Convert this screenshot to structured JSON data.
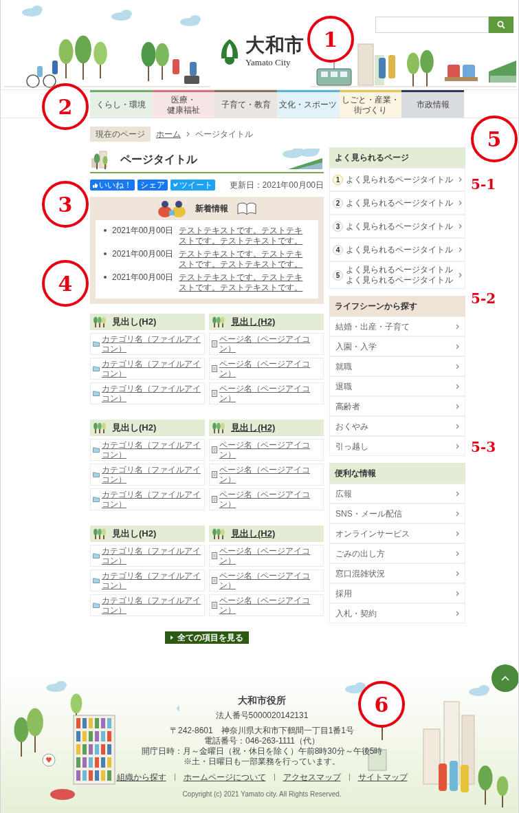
{
  "header": {
    "logo": {
      "name": "大和市",
      "romaji": "Yamato City"
    }
  },
  "nav": [
    {
      "lines": [
        "くらし・環境"
      ],
      "color": "#6fb06a"
    },
    {
      "lines": [
        "医療・",
        "健康福祉"
      ],
      "color": "#d9727a"
    },
    {
      "lines": [
        "子育て・教育"
      ],
      "color": "#8a7458"
    },
    {
      "lines": [
        "文化・スポーツ"
      ],
      "color": "#5bb5d8"
    },
    {
      "lines": [
        "しごと・産業・",
        "街づくり"
      ],
      "color": "#e8c25a"
    },
    {
      "lines": [
        "市政情報"
      ],
      "color": "#2d3a5a"
    }
  ],
  "breadcrumb": {
    "label": "現在のページ",
    "items": [
      {
        "text": "ホーム",
        "kind": "link"
      },
      {
        "text": "ページタイトル",
        "kind": "current"
      }
    ]
  },
  "page_title": "ページタイトル",
  "share_buttons": [
    {
      "label": "いいね！",
      "kind": "like"
    },
    {
      "label": "シェア",
      "kind": "share"
    },
    {
      "label": "ツイート",
      "kind": "tweet"
    }
  ],
  "updated": "更新日：2021年00月00日",
  "news": {
    "title": "新着情報",
    "items": [
      {
        "date": "2021年00月00日",
        "text": "テストテキストです。テストテキストです。テストテキストです。"
      },
      {
        "date": "2021年00月00日",
        "text": "テストテキストです。テストテキストです。テストテキストです。"
      },
      {
        "date": "2021年00月00日",
        "text": "テストテキストです。テストテキストです。テストテキストです。"
      }
    ]
  },
  "sections": [
    {
      "heading": "見出し(H2)",
      "linked": false,
      "links": [
        {
          "text": "カテゴリ名（ファイルアイコン）",
          "kind": "folder"
        },
        {
          "text": "カテゴリ名（ファイルアイコン）",
          "kind": "folder"
        },
        {
          "text": "カテゴリ名（ファイルアイコン）",
          "kind": "folder"
        }
      ]
    },
    {
      "heading": "見出し(H2)",
      "linked": true,
      "links": [
        {
          "text": "ページ名（ページアイコン）",
          "kind": "page"
        },
        {
          "text": "ページ名（ページアイコン）",
          "kind": "page"
        },
        {
          "text": "ページ名（ページアイコン）",
          "kind": "page"
        }
      ]
    },
    {
      "heading": "見出し(H2)",
      "linked": false,
      "links": [
        {
          "text": "カテゴリ名（ファイルアイコン）",
          "kind": "folder"
        },
        {
          "text": "カテゴリ名（ファイルアイコン）",
          "kind": "folder"
        },
        {
          "text": "カテゴリ名（ファイルアイコン）",
          "kind": "folder"
        }
      ]
    },
    {
      "heading": "見出し(H2)",
      "linked": true,
      "links": [
        {
          "text": "ページ名（ページアイコン）",
          "kind": "page"
        },
        {
          "text": "ページ名（ページアイコン）",
          "kind": "page"
        },
        {
          "text": "ページ名（ページアイコン）",
          "kind": "page"
        }
      ]
    },
    {
      "heading": "見出し(H2)",
      "linked": false,
      "links": [
        {
          "text": "カテゴリ名（ファイルアイコン）",
          "kind": "folder"
        },
        {
          "text": "カテゴリ名（ファイルアイコン）",
          "kind": "folder"
        },
        {
          "text": "カテゴリ名（ファイルアイコン）",
          "kind": "folder"
        }
      ]
    },
    {
      "heading": "見出し(H2)",
      "linked": true,
      "links": [
        {
          "text": "ページ名（ページアイコン）",
          "kind": "page"
        },
        {
          "text": "ページ名（ページアイコン）",
          "kind": "page"
        },
        {
          "text": "ページ名（ページアイコン）",
          "kind": "page"
        }
      ]
    }
  ],
  "all_button": "全ての項目を見る",
  "sidebar": {
    "popular": {
      "title": "よく見られるページ",
      "items": [
        {
          "rank": "1",
          "lines": [
            "よく見られるページタイトル"
          ]
        },
        {
          "rank": "2",
          "lines": [
            "よく見られるページタイトル"
          ]
        },
        {
          "rank": "3",
          "lines": [
            "よく見られるページタイトル"
          ]
        },
        {
          "rank": "4",
          "lines": [
            "よく見られるページタイトル"
          ]
        },
        {
          "rank": "5",
          "lines": [
            "よく見られるページタイトル",
            "よく見られるページタイトル"
          ]
        }
      ]
    },
    "life": {
      "title": "ライフシーンから探す",
      "items": [
        "結婚・出産・子育て",
        "入園・入学",
        "就職",
        "退職",
        "高齢者",
        "おくやみ",
        "引っ越し"
      ]
    },
    "useful": {
      "title": "便利な情報",
      "items": [
        "広報",
        "SNS・メール配信",
        "オンラインサービス",
        "ごみの出し方",
        "窓口混雑状況",
        "採用",
        "入札・契約"
      ]
    }
  },
  "footer": {
    "name": "大和市役所",
    "corporate_number": "法人番号5000020142131",
    "address_lines": [
      "〒242-8601　神奈川県大和市下鶴間一丁目1番1号",
      "電話番号：046-263-1111（代）",
      "開庁日時：月～金曜日（祝・休日を除く）午前8時30分～午後5時",
      "※土・日曜日も一部業務を行っています。"
    ],
    "links": [
      "組織から探す",
      "ホームページについて",
      "アクセスマップ",
      "サイトマップ"
    ],
    "copyright": "Copyright (c) 2021 Yamato city. All Rights Reserved."
  },
  "annotations": [
    {
      "label": "1",
      "kind": "circle"
    },
    {
      "label": "2",
      "kind": "circle"
    },
    {
      "label": "3",
      "kind": "circle"
    },
    {
      "label": "4",
      "kind": "circle"
    },
    {
      "label": "5",
      "kind": "circle"
    },
    {
      "label": "5-1",
      "kind": "tag"
    },
    {
      "label": "5-2",
      "kind": "tag"
    },
    {
      "label": "5-3",
      "kind": "tag"
    },
    {
      "label": "6",
      "kind": "circle"
    }
  ]
}
